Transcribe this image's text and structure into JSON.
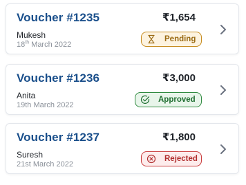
{
  "vouchers": [
    {
      "id": "Voucher #1235",
      "amount": "₹1,654",
      "name": "Mukesh",
      "date_day": "18",
      "date_suffix": "th",
      "date_rest": " March 2022",
      "status": "Pending",
      "status_icon": "hourglass-icon"
    },
    {
      "id": "Voucher #1236",
      "amount": "₹3,000",
      "name": "Anita",
      "date": "19th March 2022",
      "status": "Approved",
      "status_icon": "check-circle-icon"
    },
    {
      "id": "Voucher #1237",
      "amount": "₹1,800",
      "name": "Suresh",
      "date": "21st March 2022",
      "status": "Rejected",
      "status_icon": "x-circle-icon"
    }
  ],
  "colors": {
    "voucher_id": "#1a4f8b",
    "pending": "#c68a1c",
    "approved": "#2f8a3f",
    "rejected": "#c93a3a"
  },
  "icons": {
    "row_action": "chevron-right-icon"
  }
}
